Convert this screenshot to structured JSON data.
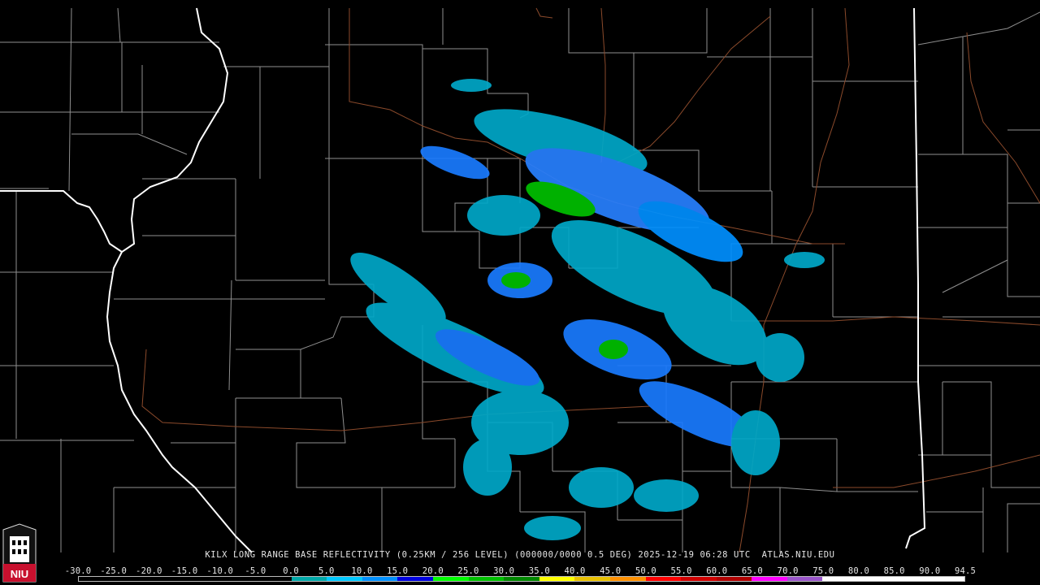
{
  "caption": "KILX LONG RANGE BASE REFLECTIVITY (0.25KM / 256 LEVEL) (000000/0000 0.5 DEG) 2025-12-19 06:28 UTC  ATLAS.NIU.EDU",
  "logo_text": "NIU",
  "scale": {
    "labels": [
      "-30.0",
      "-25.0",
      "-20.0",
      "-15.0",
      "-10.0",
      "-5.0",
      "0.0",
      "5.0",
      "10.0",
      "15.0",
      "20.0",
      "25.0",
      "30.0",
      "35.0",
      "40.0",
      "45.0",
      "50.0",
      "55.0",
      "60.0",
      "65.0",
      "70.0",
      "75.0",
      "80.0",
      "85.0",
      "90.0",
      "94.5"
    ],
    "colors": [
      "#000000",
      "#000000",
      "#000000",
      "#000000",
      "#000000",
      "#000000",
      "#00a8a8",
      "#00c8ff",
      "#0090ff",
      "#0000e0",
      "#00ff00",
      "#00c000",
      "#008800",
      "#ffff00",
      "#e8c000",
      "#ff9000",
      "#ff0000",
      "#d00000",
      "#b00000",
      "#ff00ff",
      "#9955c9",
      "#ffffff",
      "#ffffff",
      "#ffffff",
      "#ffffff"
    ]
  },
  "colors": {
    "background": "#000000",
    "county_lines": "#9a9a9a",
    "state_lines": "#ffffff",
    "highways": "#8b4a2b"
  }
}
